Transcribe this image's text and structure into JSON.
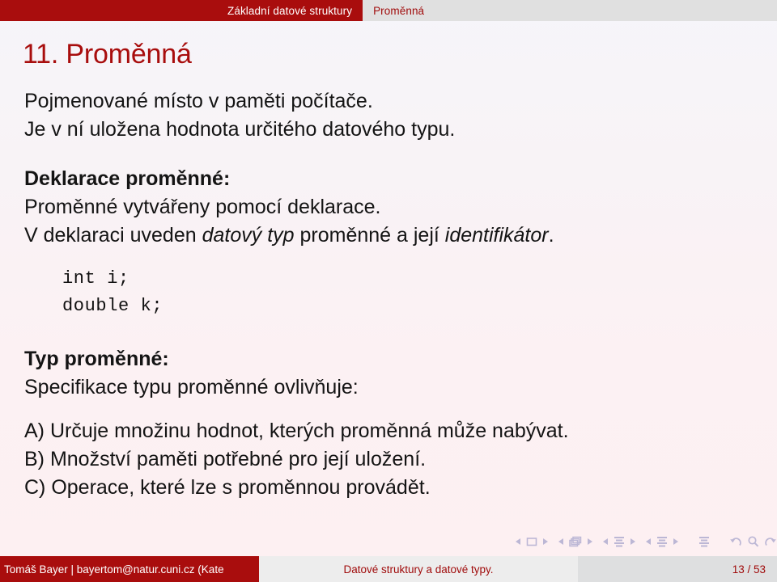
{
  "header": {
    "section_tab": "Základní datové struktury",
    "subsection_tab": "Proměnná",
    "active_color": "#a90d0d",
    "inactive_bg": "#e0e0e0",
    "inactive_text_color": "#a00c0c"
  },
  "slide": {
    "title": "11. Proměnná",
    "title_color": "#a80d0d",
    "background_color": "#fbf1f3",
    "lines": {
      "l1": "Pojmenované místo v paměti počítače.",
      "l2": "Je v ní uložena hodnota určitého datového typu.",
      "l3": "Deklarace proměnné:",
      "l4": "Proměnné vytvářeny pomocí deklarace.",
      "l5_a": "V deklaraci uveden ",
      "l5_b": "datový typ",
      "l5_c": " proměnné a její ",
      "l5_d": "identifikátor",
      "l5_e": ".",
      "code1": "int i;",
      "code2": "double k;",
      "l6": "Typ proměnné:",
      "l7": "Specifikace typu proměnné ovlivňuje:",
      "l8": "A) Určuje množinu hodnot, kterých proměnná může nabývat.",
      "l9": "B) Množství paměti potřebné pro její uložení.",
      "l10": "C) Operace, které lze s proměnnou provádět."
    }
  },
  "navigation": {
    "slide_prev": "slide-prev",
    "slide_icon": "slide-icon",
    "slide_next": "slide-next",
    "frame_prev": "frame-prev",
    "frame_icon": "frame-icon",
    "frame_next": "frame-next",
    "subsection_prev": "subsection-prev",
    "subsection_icon": "subsection-icon",
    "subsection_next": "subsection-next",
    "section_prev": "section-prev",
    "section_icon": "section-icon",
    "section_next": "section-next",
    "doc_icon": "document-icon",
    "back_icon": "go-back-icon",
    "search_icon": "search-icon",
    "forward_icon": "go-forward-icon",
    "color": "#b9b4d4"
  },
  "footer": {
    "author": "Tomáš Bayer | bayertom@natur.cuni.cz  (Kate",
    "title": "Datové struktury a datové typy.",
    "page": "13 / 53",
    "author_bg": "#a90d0d",
    "title_bg": "#ededed",
    "page_bg": "#dedfe0",
    "text_color": "#a00c0c"
  }
}
